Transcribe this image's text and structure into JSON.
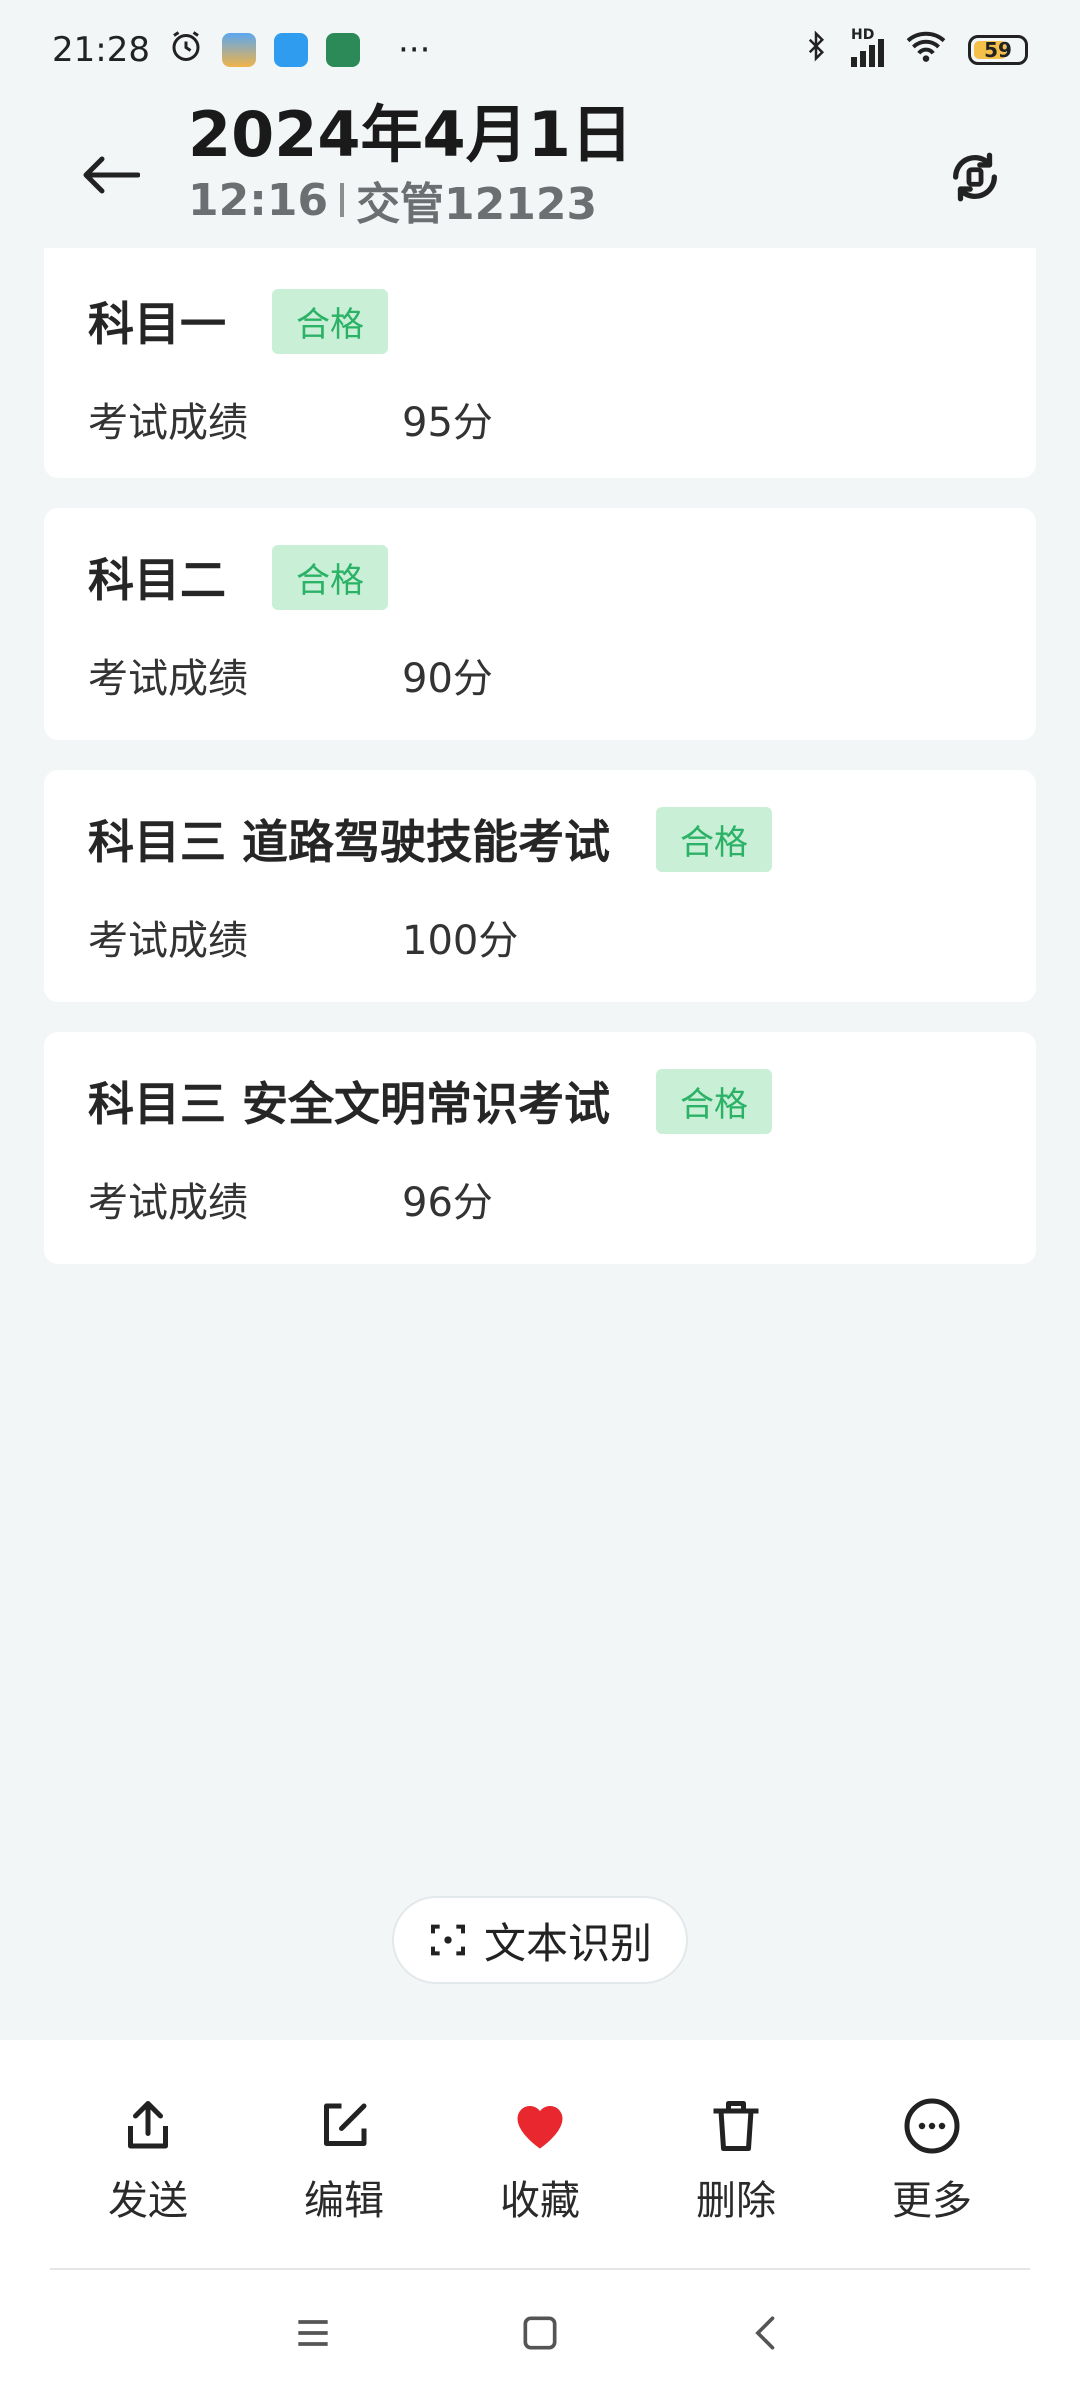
{
  "status_bar": {
    "time": "21:28",
    "more": "···",
    "network_label": "HD",
    "battery": "59"
  },
  "header": {
    "date": "2024年4月1日",
    "time": "12:16",
    "source": "交管12123"
  },
  "score_label": "考试成绩",
  "cards": [
    {
      "subject": "科目一",
      "status": "合格",
      "score": "95分"
    },
    {
      "subject": "科目二",
      "status": "合格",
      "score": "90分"
    },
    {
      "subject": "科目三 道路驾驶技能考试",
      "status": "合格",
      "score": "100分"
    },
    {
      "subject": "科目三 安全文明常识考试",
      "status": "合格",
      "score": "96分"
    }
  ],
  "ocr_button": {
    "label": "文本识别"
  },
  "toolbar": {
    "send": "发送",
    "edit": "编辑",
    "favorite": "收藏",
    "delete": "删除",
    "more": "更多"
  },
  "colors": {
    "badge_bg": "#c9efd7",
    "badge_text": "#2bb266",
    "favorite": "#e8282e",
    "background": "#f2f6f7"
  }
}
